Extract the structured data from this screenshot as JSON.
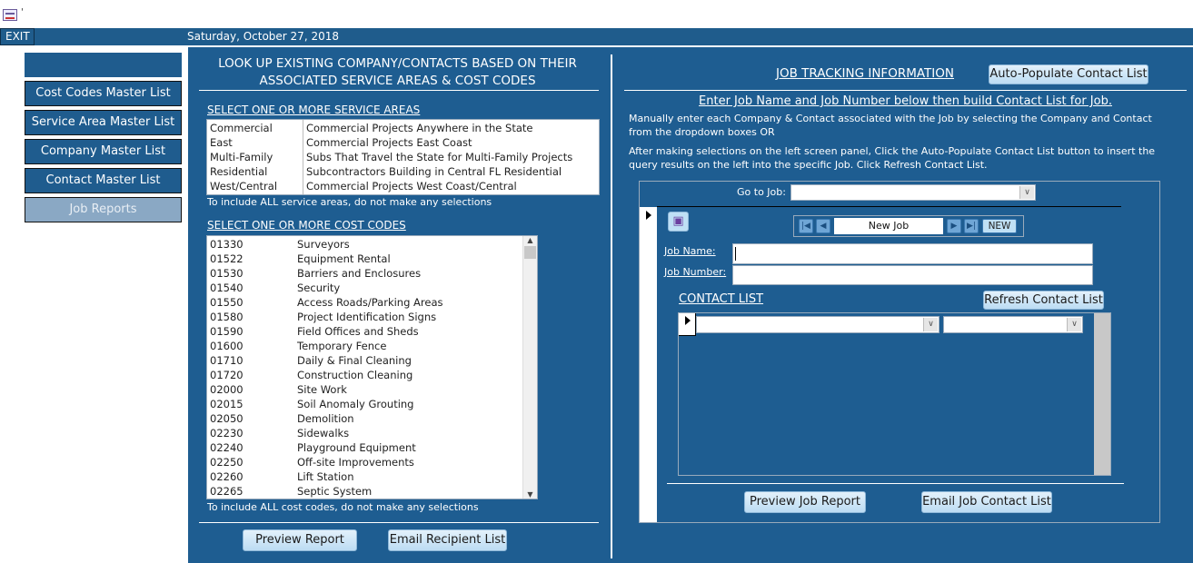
{
  "window": {
    "icon": "form-icon",
    "title": "'"
  },
  "header": {
    "exit_label": "EXIT",
    "date": "Saturday, October 27, 2018"
  },
  "sidebar": {
    "items": [
      {
        "label": ""
      },
      {
        "label": "Cost Codes Master List"
      },
      {
        "label": "Service Area Master List"
      },
      {
        "label": "Company Master List"
      },
      {
        "label": "Contact Master List"
      },
      {
        "label": "Job Reports",
        "active": true
      }
    ]
  },
  "lookup": {
    "title_line1": "LOOK UP EXISTING COMPANY/CONTACTS BASED ON THEIR",
    "title_line2": "ASSOCIATED SERVICE AREAS & COST CODES",
    "service_heading": "SELECT ONE OR MORE SERVICE AREAS",
    "service_areas": [
      [
        "Commercial",
        "Commercial Projects Anywhere in the State"
      ],
      [
        "East",
        "Commercial Projects East Coast"
      ],
      [
        "Multi-Family",
        "Subs That Travel the State for Multi-Family Projects"
      ],
      [
        "Residential",
        "Subcontractors Building in Central FL Residential"
      ],
      [
        "West/Central",
        "Commercial Projects West Coast/Central"
      ]
    ],
    "service_note": "To include ALL service areas, do not make any selections",
    "cost_heading": "SELECT ONE OR MORE COST CODES",
    "cost_codes": [
      [
        "01330",
        "Surveyors"
      ],
      [
        "01522",
        "Equipment Rental"
      ],
      [
        "01530",
        "Barriers and Enclosures"
      ],
      [
        "01540",
        "Security"
      ],
      [
        "01550",
        "Access Roads/Parking Areas"
      ],
      [
        "01580",
        "Project Identification Signs"
      ],
      [
        "01590",
        "Field Offices and Sheds"
      ],
      [
        "01600",
        "Temporary Fence"
      ],
      [
        "01710",
        "Daily & Final Cleaning"
      ],
      [
        "01720",
        "Construction Cleaning"
      ],
      [
        "02000",
        "Site Work"
      ],
      [
        "02015",
        "Soil Anomaly Grouting"
      ],
      [
        "02050",
        "Demolition"
      ],
      [
        "02230",
        "Sidewalks"
      ],
      [
        "02240",
        "Playground Equipment"
      ],
      [
        "02250",
        "Off-site Improvements"
      ],
      [
        "02260",
        "Lift Station"
      ],
      [
        "02265",
        "Septic System"
      ]
    ],
    "cost_note": "To include ALL cost codes, do not make any selections",
    "preview_label": "Preview Report",
    "email_label": "Email Recipient List"
  },
  "job": {
    "title": "JOB TRACKING INFORMATION",
    "autopopulate_label": "Auto-Populate Contact List",
    "instruction": "Enter Job Name and Job Number below then build Contact List for Job.",
    "para1": "Manually enter each Company & Contact associated with the Job by selecting the Company and Contact from the dropdown boxes OR",
    "para2": "After making selections on the left screen panel, Click the Auto-Populate Contact List button to insert the query results on the left into the specific Job. Click Refresh Contact List.",
    "goto_label": "Go to Job:",
    "goto_value": "",
    "record_value": "New Job",
    "new_label": "NEW",
    "job_name_label": "Job Name:",
    "job_name_value": "",
    "job_number_label": "Job Number:",
    "job_number_value": "",
    "contact_list_label": "CONTACT LIST",
    "refresh_label": "Refresh Contact List",
    "preview_label": "Preview Job Report",
    "email_label": "Email Job Contact List"
  }
}
